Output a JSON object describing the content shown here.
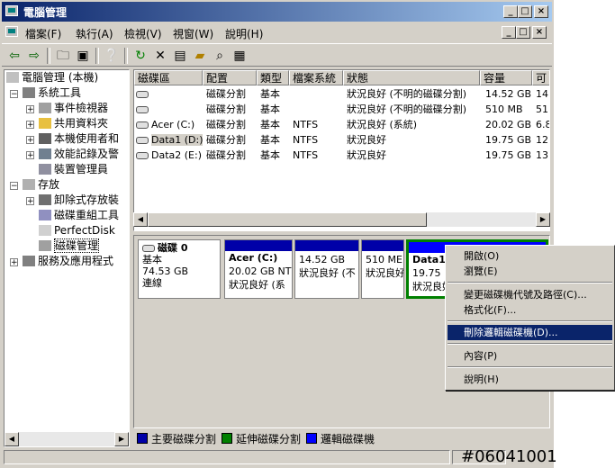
{
  "window": {
    "title": "電腦管理",
    "caption_buttons": [
      "_",
      "□",
      "×"
    ],
    "inner_buttons": [
      "_",
      "□",
      "×"
    ]
  },
  "menu": [
    "檔案(F)",
    "執行(A)",
    "檢視(V)",
    "視窗(W)",
    "說明(H)"
  ],
  "toolbar": {
    "icons": [
      "back-icon",
      "forward-icon",
      "up-folder-icon",
      "show-tree-icon",
      "properties-icon",
      "refresh-icon",
      "delete-icon",
      "disk-properties-icon",
      "open-icon",
      "search-icon",
      "help-icon"
    ]
  },
  "tree": {
    "root": "電腦管理 (本機)",
    "system_tools": "系統工具",
    "event_viewer": "事件檢視器",
    "shared_folders": "共用資料夾",
    "local_users": "本機使用者和",
    "perf_logs": "效能記錄及警",
    "device_manager": "裝置管理員",
    "storage": "存放",
    "removable": "卸除式存放裝",
    "defrag": "磁碟重組工具",
    "perfectdisk": "PerfectDisk",
    "disk_mgmt": "磁碟管理",
    "services": "服務及應用程式"
  },
  "table": {
    "headers": [
      "磁碟區",
      "配置",
      "類型",
      "檔案系統",
      "狀態",
      "容量",
      "可"
    ],
    "rows": [
      {
        "vol": "",
        "layout": "磁碟分割",
        "type": "基本",
        "fs": "",
        "status": "狀況良好 (不明的磁碟分割)",
        "cap": "14.52 GB",
        "free": "14."
      },
      {
        "vol": "",
        "layout": "磁碟分割",
        "type": "基本",
        "fs": "",
        "status": "狀況良好 (不明的磁碟分割)",
        "cap": "510 MB",
        "free": "51"
      },
      {
        "vol": "Acer (C:)",
        "layout": "磁碟分割",
        "type": "基本",
        "fs": "NTFS",
        "status": "狀況良好 (系統)",
        "cap": "20.02 GB",
        "free": "6.8"
      },
      {
        "vol": "Data1 (D:)",
        "layout": "磁碟分割",
        "type": "基本",
        "fs": "NTFS",
        "status": "狀況良好",
        "cap": "19.75 GB",
        "free": "12."
      },
      {
        "vol": "Data2 (E:)",
        "layout": "磁碟分割",
        "type": "基本",
        "fs": "NTFS",
        "status": "狀況良好",
        "cap": "19.75 GB",
        "free": "13."
      }
    ]
  },
  "disk": {
    "name": "磁碟 0",
    "type": "基本",
    "size": "74.53 GB",
    "state": "連線",
    "partitions": [
      {
        "title": "Acer (C:)",
        "size": "20.02 GB NTF",
        "status": "狀況良好 (系"
      },
      {
        "title": "",
        "size": "14.52 GB",
        "status": "狀況良好 (不"
      },
      {
        "title": "",
        "size": "510 ME",
        "status": "狀況良好"
      },
      {
        "title": "Data1",
        "size": "19.75",
        "status": "狀況良好"
      }
    ]
  },
  "legend": [
    {
      "label": "主要磁碟分割",
      "color": "#0000a8"
    },
    {
      "label": "延伸磁碟分割",
      "color": "#008000"
    },
    {
      "label": "邏輯磁碟機",
      "color": "#0000ff"
    }
  ],
  "context_menu": {
    "items": [
      "開啟(O)",
      "瀏覽(E)",
      "變更磁碟機代號及路徑(C)...",
      "格式化(F)...",
      "刪除邏輯磁碟機(D)...",
      "內容(P)",
      "說明(H)"
    ],
    "selected": "刪除邏輯磁碟機(D)..."
  },
  "watermark": "#06041001"
}
